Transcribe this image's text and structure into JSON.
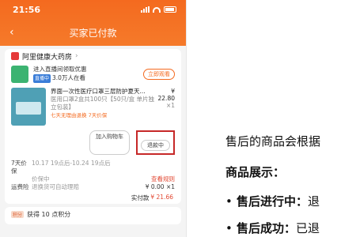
{
  "status": {
    "time": "21:56"
  },
  "header": {
    "back_icon": "back-chevron-icon",
    "title": "买家已付款"
  },
  "store": {
    "name": "阿里健康大药房",
    "icon": "store-icon"
  },
  "live": {
    "title": "进入直播间领取优惠",
    "badge": "直播中",
    "watchers": "3.0万人在看",
    "button": "立即观看"
  },
  "product": {
    "name": "界面一次性医疗口罩三层防护夏天...",
    "desc": "医用口罩2盒共100只【50只/盒 单片独立包装】",
    "tags": "七天无理由退换 7天价保",
    "price": "¥ 22.80",
    "qty": "×1"
  },
  "actions": {
    "add_cart": "加入购物车",
    "refund": "退款中"
  },
  "price_protect": {
    "label": "7天价保",
    "range": "10.17 19点后-10.24 19点后",
    "sub": "价保中",
    "link": "查看规则"
  },
  "shipping": {
    "label": "运费险",
    "value": "退换货可自动理赔",
    "amount": "¥ 0.00 ×1"
  },
  "total": {
    "label": "实付款",
    "amount": "¥ 21.66"
  },
  "points": {
    "badge": "积分",
    "text": "获得 10 点积分"
  },
  "right_text": {
    "line1": "售后的商品会根据",
    "line2": "商品展示：",
    "line3_bold": "售后进行中：",
    "line3_rest": "退",
    "line4_bold": "售后成功：",
    "line4_rest": "已退"
  }
}
